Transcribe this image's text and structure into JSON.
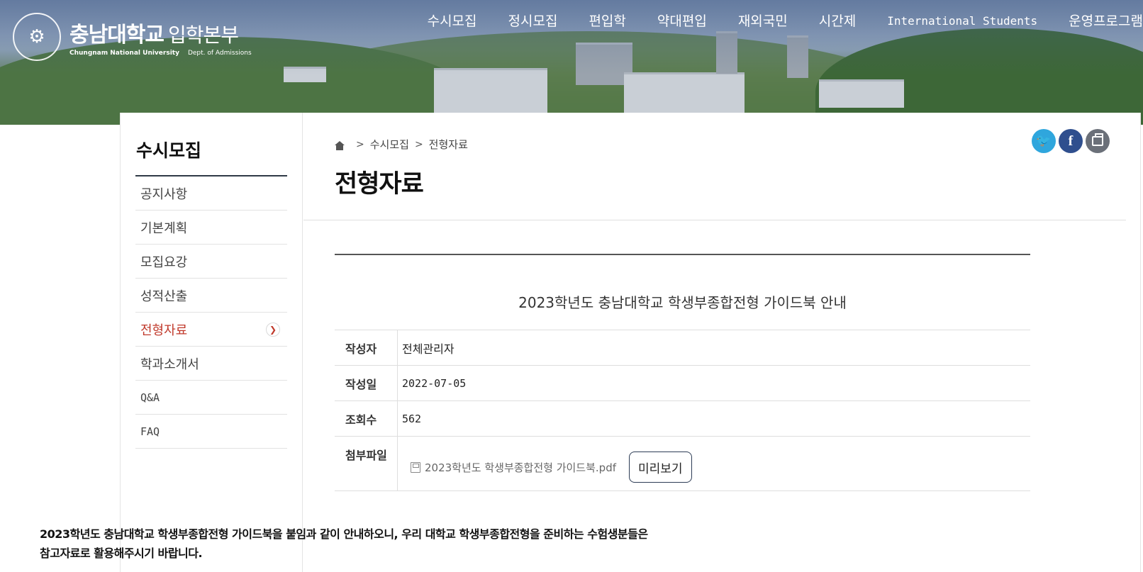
{
  "header": {
    "logo_ko": "충남대학교",
    "logo_ko_sub": "입학본부",
    "logo_en": "Chungnam National University",
    "logo_en_sub": "Dept. of Admissions",
    "emblem_icon": "university-emblem-icon",
    "nav": [
      "수시모집",
      "정시모집",
      "편입학",
      "약대편입",
      "재외국민",
      "시간제",
      "International Students",
      "운영프로그램"
    ]
  },
  "sidebar": {
    "title": "수시모집",
    "items": [
      {
        "label": "공지사항"
      },
      {
        "label": "기본계획"
      },
      {
        "label": "모집요강"
      },
      {
        "label": "성적산출"
      },
      {
        "label": "전형자료"
      },
      {
        "label": "학과소개서"
      },
      {
        "label": "Q&A"
      },
      {
        "label": "FAQ"
      }
    ],
    "active_index": 4,
    "active_color": "#c0392b"
  },
  "breadcrumb": {
    "home_icon": "home-icon",
    "items": [
      "수시모집",
      "전형자료"
    ]
  },
  "page_title": "전형자료",
  "sns": {
    "twitter_glyph": "🐦",
    "facebook_glyph": "f",
    "icons": [
      "twitter-icon",
      "facebook-icon",
      "print-icon"
    ],
    "colors": {
      "twitter": "#2fa6dd",
      "facebook": "#2f4f8e",
      "print": "#6b7079"
    }
  },
  "post": {
    "title": "2023학년도 충남대학교 학생부종합전형 가이드북 안내",
    "author_label": "작성자",
    "author": "전체관리자",
    "date_label": "작성일",
    "date": "2022-07-05",
    "views_label": "조회수",
    "views": "562",
    "attachment_label": "첨부파일",
    "attachment_name": "2023학년도 학생부종합전형 가이드북.pdf",
    "preview_label": "미리보기",
    "body_line1": "2023학년도 충남대학교 학생부종합전형 가이드북을 붙임과 같이 안내하오니, 우리 대학교 학생부종합전형을 준비하는 수험생분들은",
    "body_line2": "참고자료로 활용해주시기 바랍니다."
  }
}
